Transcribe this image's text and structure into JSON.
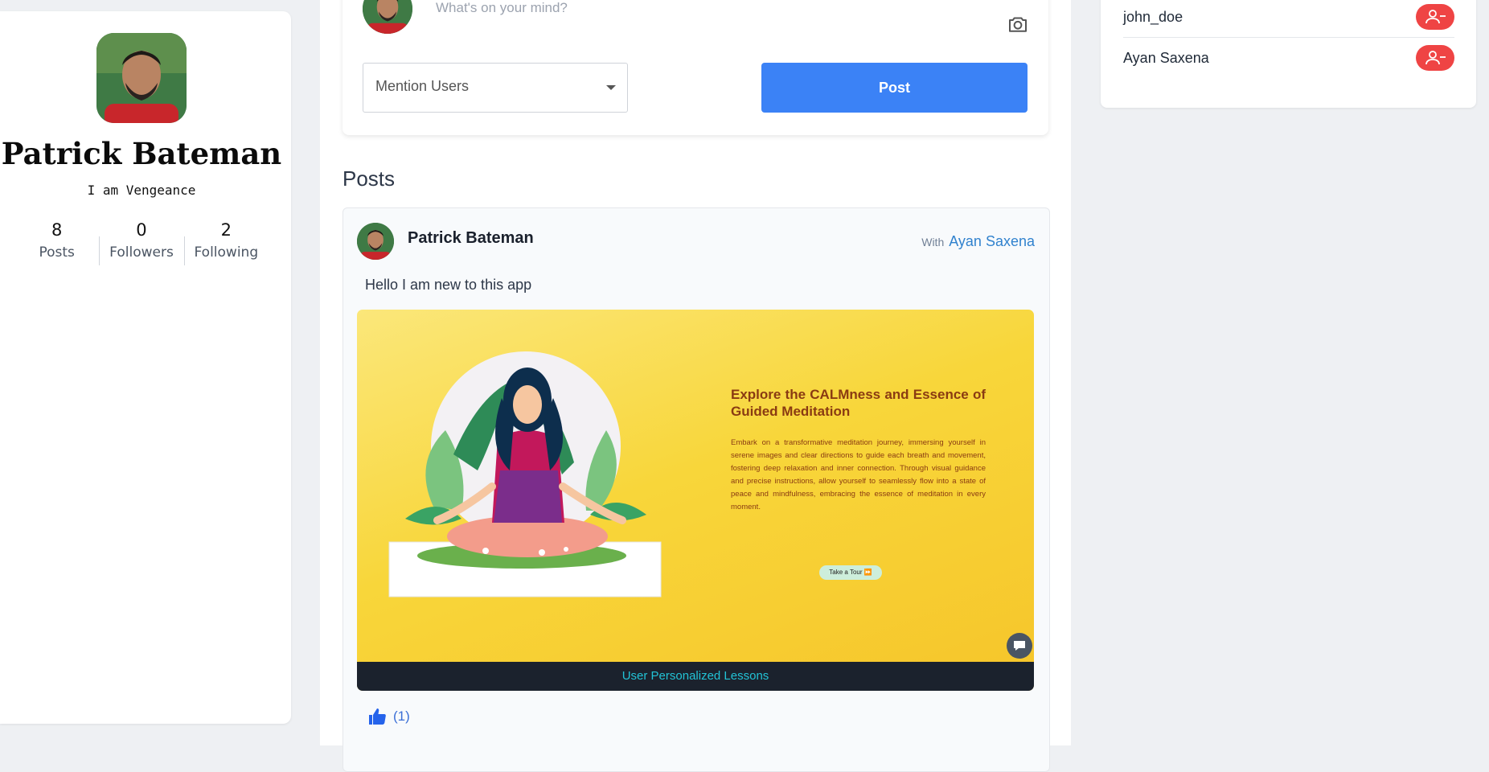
{
  "profile": {
    "name": "Patrick Bateman",
    "bio": "I am Vengeance",
    "stats": [
      {
        "value": "8",
        "label": "Posts"
      },
      {
        "value": "0",
        "label": "Followers"
      },
      {
        "value": "2",
        "label": "Following"
      }
    ]
  },
  "composer": {
    "placeholder": "What's on your mind?",
    "mention_label": "Mention Users",
    "post_button": "Post"
  },
  "posts_section": {
    "heading": "Posts"
  },
  "post": {
    "author": "Patrick Bateman",
    "with_word": "With",
    "mention": "Ayan Saxena",
    "text": "Hello I am new to this app",
    "image": {
      "title": "Explore the CALMness and Essence of Guided Meditation",
      "body": "Embark on a transformative meditation journey, immersing yourself in serene images and clear directions to guide each breath and movement, fostering deep relaxation and inner connection. Through visual guidance and precise instructions, allow yourself to seamlessly flow into a state of peace and mindfulness, embracing the essence of meditation in every moment.",
      "tour_button": "Take a Tour ⏩",
      "caption": "User Personalized Lessons"
    },
    "likes": "(1)"
  },
  "following": [
    {
      "name": "john_doe"
    },
    {
      "name": "Ayan Saxena"
    }
  ],
  "colors": {
    "accent": "#3b82f6",
    "danger": "#ef4444",
    "link": "#3182ce"
  }
}
